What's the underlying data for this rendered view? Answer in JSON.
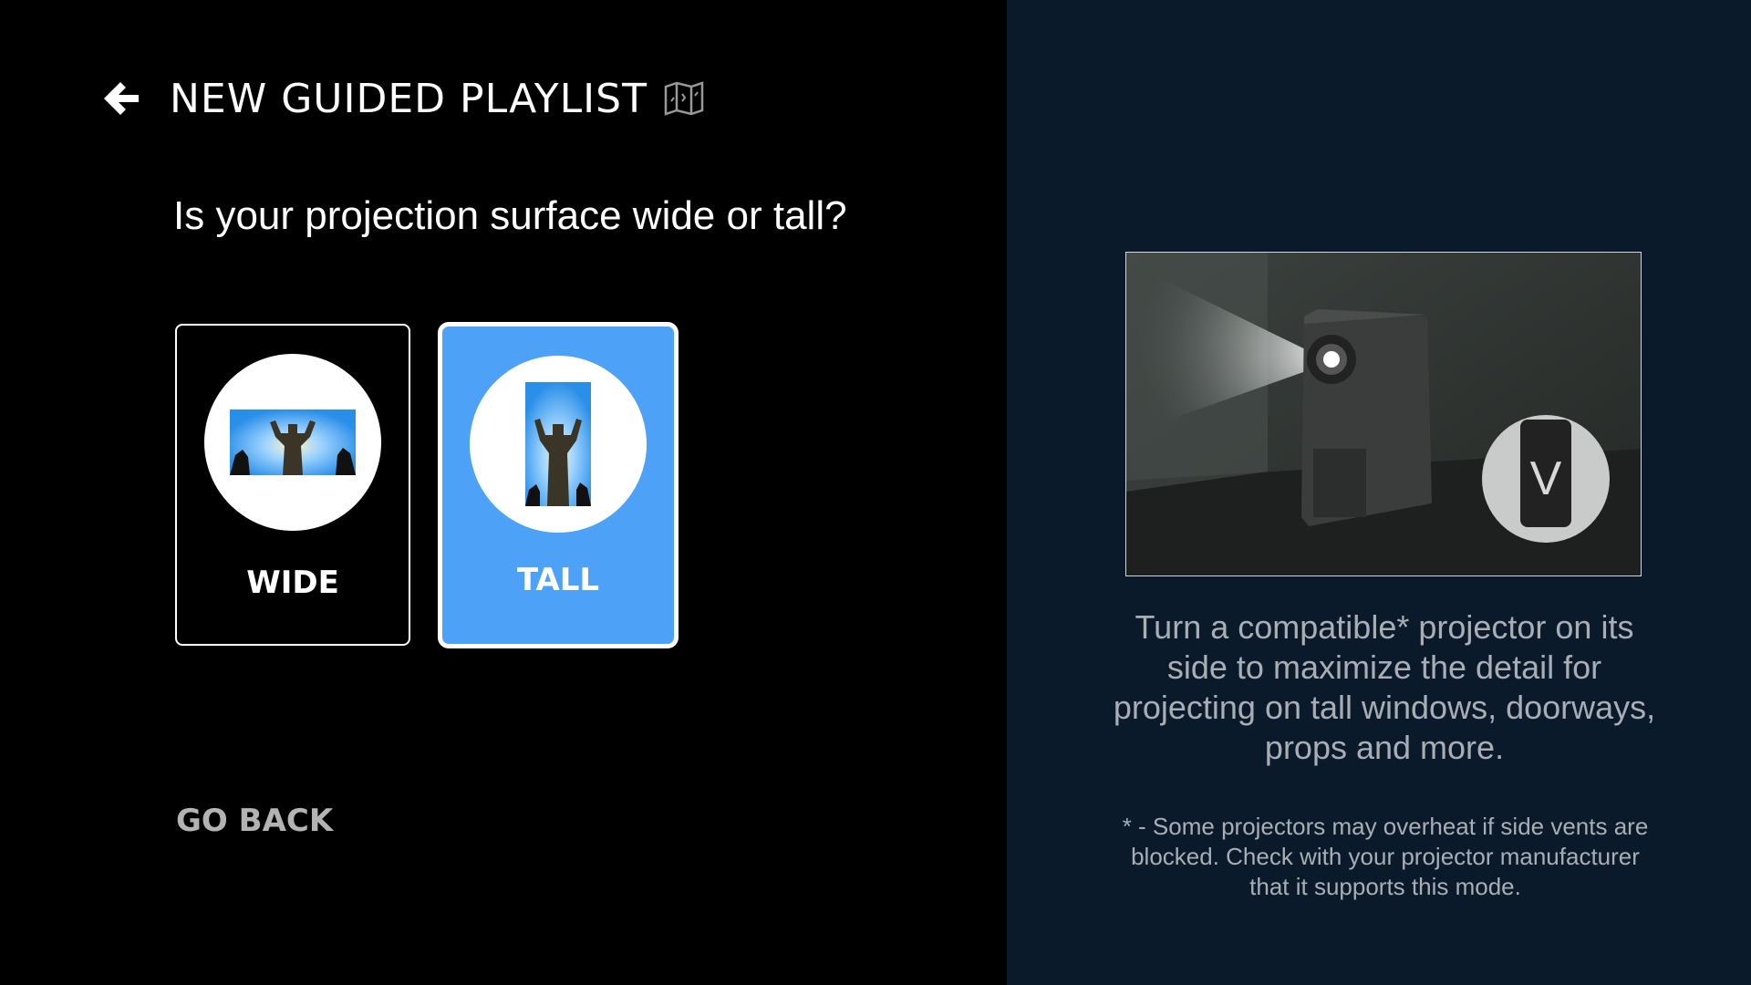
{
  "header": {
    "title": "NEW GUIDED PLAYLIST",
    "back_icon": "back-arrow-icon",
    "guide_icon": "map-icon"
  },
  "question": "Is your projection surface wide or tall?",
  "options": [
    {
      "label": "WIDE",
      "selected": false
    },
    {
      "label": "TALL",
      "selected": true
    }
  ],
  "go_back_label": "GO BACK",
  "info": {
    "orientation_badge": "V",
    "description": "Turn a compatible* projector on its side to maximize the detail for projecting on tall windows, doorways, props and more.",
    "footnote": "* - Some projectors may overheat if side vents are blocked.  Check with your projector manufacturer that it supports this mode."
  },
  "colors": {
    "left_background": "#000000",
    "right_background": "#0b1a2a",
    "selected_card": "#4da1f7",
    "muted_text": "#a8aeb4"
  }
}
